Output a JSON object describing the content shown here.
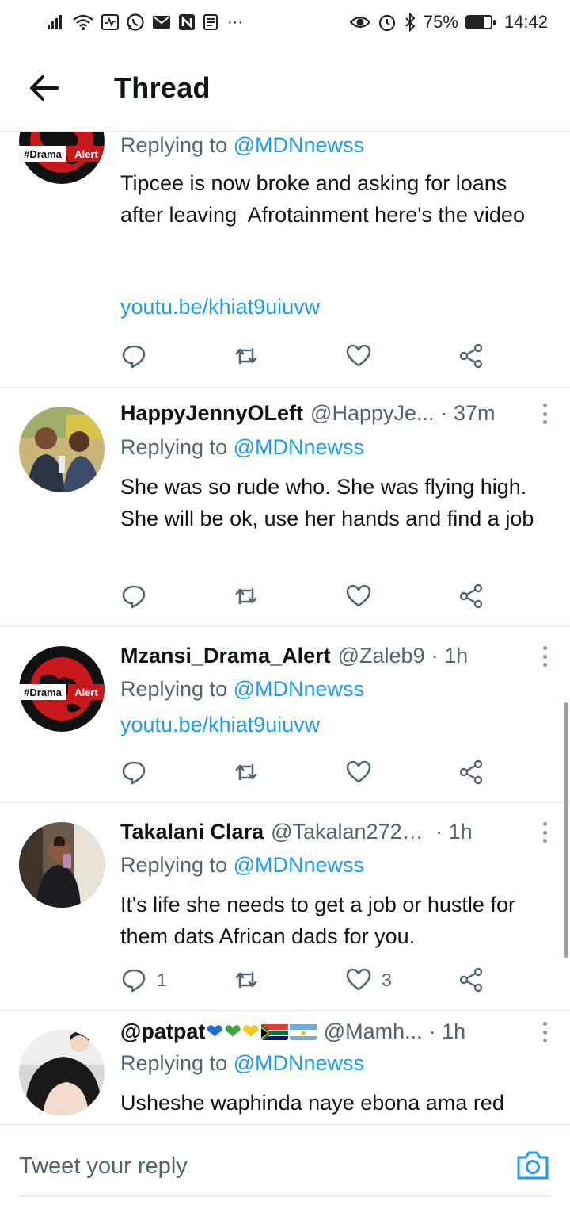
{
  "status_bar": {
    "left_extra": "···",
    "battery": "75%",
    "time": "14:42"
  },
  "header": {
    "title": "Thread"
  },
  "tweets": [
    {
      "author": "",
      "handle": "",
      "time": "",
      "replying_prefix": "Replying to ",
      "replying_to": "@MDNnewss",
      "text": "Tipcee is now broke and asking for loans after leaving  Afrotainment here's the video",
      "link": "youtu.be/khiat9uiuvw",
      "avatar": "drama-alert",
      "reply_count": "",
      "like_count": ""
    },
    {
      "author": "HappyJennyOLeft",
      "handle": "@HappyJe...",
      "time": "· 37m",
      "replying_prefix": "Replying to ",
      "replying_to": "@MDNnewss",
      "text": "She was so rude who. She was flying high. She will be ok, use her hands and find a job",
      "link": "",
      "avatar": "photo-people",
      "reply_count": "",
      "like_count": ""
    },
    {
      "author": "Mzansi_Drama_Alert",
      "handle": "@Zaleb9",
      "time": "· 1h",
      "replying_prefix": "Replying to ",
      "replying_to": "@MDNnewss",
      "text": "",
      "link": "youtu.be/khiat9uiuvw",
      "avatar": "drama-alert",
      "reply_count": "",
      "like_count": ""
    },
    {
      "author": "Takalani Clara",
      "handle": "@Takalan27279...",
      "time": "· 1h",
      "replying_prefix": "Replying to ",
      "replying_to": "@MDNnewss",
      "text": "It's life she needs to get a job or hustle for them dats African dads for you.",
      "link": "",
      "avatar": "photo-selfie",
      "reply_count": "1",
      "like_count": "3"
    },
    {
      "author": "@patpat",
      "handle": "@Mamh...",
      "time": "· 1h",
      "replying_prefix": "Replying to ",
      "replying_to": "@MDNnewss",
      "text": "Usheshe waphinda naye ebona ama red",
      "link": "",
      "avatar": "photo-face",
      "reply_count": "",
      "like_count": ""
    }
  ],
  "avatar_badge": {
    "left": "#Drama",
    "right": "Alert"
  },
  "reply_bar": {
    "placeholder": "Tweet your reply"
  },
  "colors": {
    "accent": "#1d9bf0",
    "text": "#0f1419",
    "muted": "#536471",
    "divider": "#e6ecf0"
  }
}
